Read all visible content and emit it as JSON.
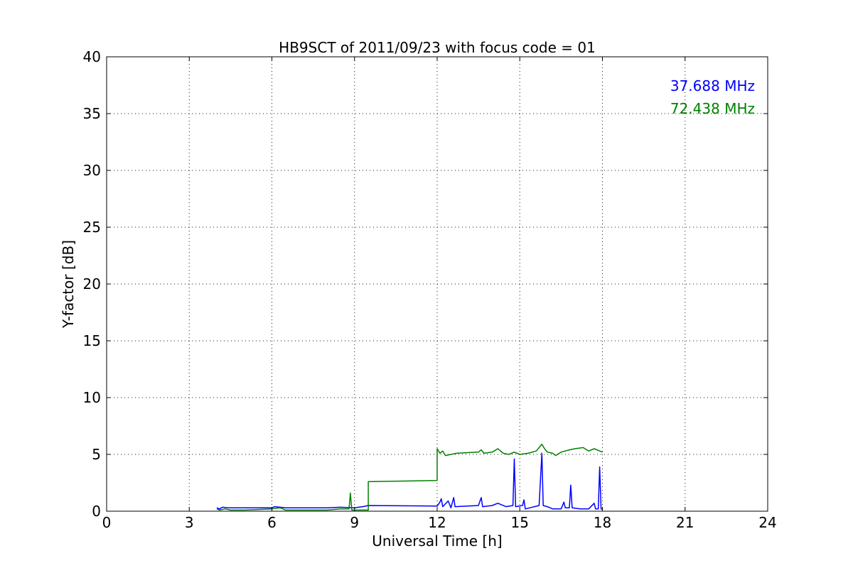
{
  "chart_data": {
    "type": "line",
    "title": "HB9SCT of 2011/09/23 with focus code = 01",
    "xlabel": "Universal Time [h]",
    "ylabel": "Y-factor [dB]",
    "xlim": [
      0,
      24
    ],
    "ylim": [
      0,
      40
    ],
    "xticks": [
      0,
      3,
      6,
      9,
      12,
      15,
      18,
      21,
      24
    ],
    "yticks": [
      0,
      5,
      10,
      15,
      20,
      25,
      30,
      35,
      40
    ],
    "grid": true,
    "legend_position": "top-right",
    "series": [
      {
        "name": "37.688 MHz",
        "color": "#0000ff",
        "points": [
          [
            4.0,
            0.3
          ],
          [
            4.1,
            0.2
          ],
          [
            4.2,
            0.35
          ],
          [
            4.4,
            0.3
          ],
          [
            4.5,
            0.3
          ],
          [
            6.0,
            0.3
          ],
          [
            6.1,
            0.4
          ],
          [
            6.3,
            0.35
          ],
          [
            6.5,
            0.3
          ],
          [
            8.0,
            0.3
          ],
          [
            8.5,
            0.35
          ],
          [
            9.0,
            0.3
          ],
          [
            9.3,
            0.4
          ],
          [
            9.5,
            0.5
          ],
          [
            12.0,
            0.45
          ],
          [
            12.1,
            0.8
          ],
          [
            12.15,
            1.1
          ],
          [
            12.2,
            0.4
          ],
          [
            12.4,
            0.9
          ],
          [
            12.5,
            0.3
          ],
          [
            12.6,
            1.2
          ],
          [
            12.65,
            0.4
          ],
          [
            13.5,
            0.5
          ],
          [
            13.6,
            1.2
          ],
          [
            13.65,
            0.4
          ],
          [
            14.0,
            0.5
          ],
          [
            14.2,
            0.7
          ],
          [
            14.5,
            0.4
          ],
          [
            14.75,
            0.5
          ],
          [
            14.8,
            4.6
          ],
          [
            14.85,
            0.4
          ],
          [
            15.1,
            0.5
          ],
          [
            15.15,
            1.0
          ],
          [
            15.2,
            0.2
          ],
          [
            15.7,
            0.5
          ],
          [
            15.8,
            5.1
          ],
          [
            15.85,
            0.5
          ],
          [
            16.0,
            0.4
          ],
          [
            16.2,
            0.2
          ],
          [
            16.5,
            0.2
          ],
          [
            16.6,
            0.8
          ],
          [
            16.65,
            0.3
          ],
          [
            16.8,
            0.3
          ],
          [
            16.85,
            2.3
          ],
          [
            16.9,
            0.3
          ],
          [
            17.2,
            0.2
          ],
          [
            17.5,
            0.2
          ],
          [
            17.7,
            0.7
          ],
          [
            17.75,
            0.2
          ],
          [
            17.85,
            0.2
          ],
          [
            17.9,
            3.9
          ],
          [
            17.95,
            0.2
          ],
          [
            18.0,
            0.15
          ]
        ]
      },
      {
        "name": "72.438 MHz",
        "color": "#008000",
        "points": [
          [
            4.0,
            0.2
          ],
          [
            4.1,
            0.1
          ],
          [
            4.3,
            0.2
          ],
          [
            4.5,
            0.1
          ],
          [
            5.0,
            0.1
          ],
          [
            6.0,
            0.2
          ],
          [
            6.3,
            0.3
          ],
          [
            6.5,
            0.1
          ],
          [
            8.0,
            0.1
          ],
          [
            8.5,
            0.2
          ],
          [
            8.8,
            0.2
          ],
          [
            8.85,
            1.6
          ],
          [
            8.9,
            0.1
          ],
          [
            9.5,
            0.1
          ],
          [
            9.5,
            2.6
          ],
          [
            12.0,
            2.7
          ],
          [
            12.0,
            5.5
          ],
          [
            12.1,
            5.1
          ],
          [
            12.2,
            5.3
          ],
          [
            12.3,
            4.9
          ],
          [
            12.5,
            5.0
          ],
          [
            12.7,
            5.1
          ],
          [
            13.5,
            5.2
          ],
          [
            13.6,
            5.4
          ],
          [
            13.7,
            5.1
          ],
          [
            14.0,
            5.2
          ],
          [
            14.2,
            5.5
          ],
          [
            14.4,
            5.1
          ],
          [
            14.6,
            5.0
          ],
          [
            14.8,
            5.2
          ],
          [
            15.0,
            5.0
          ],
          [
            15.3,
            5.1
          ],
          [
            15.6,
            5.3
          ],
          [
            15.8,
            5.9
          ],
          [
            15.9,
            5.5
          ],
          [
            16.0,
            5.2
          ],
          [
            16.2,
            5.1
          ],
          [
            16.3,
            4.9
          ],
          [
            16.5,
            5.2
          ],
          [
            16.8,
            5.4
          ],
          [
            17.0,
            5.5
          ],
          [
            17.3,
            5.6
          ],
          [
            17.5,
            5.3
          ],
          [
            17.7,
            5.5
          ],
          [
            18.0,
            5.2
          ]
        ]
      }
    ]
  }
}
